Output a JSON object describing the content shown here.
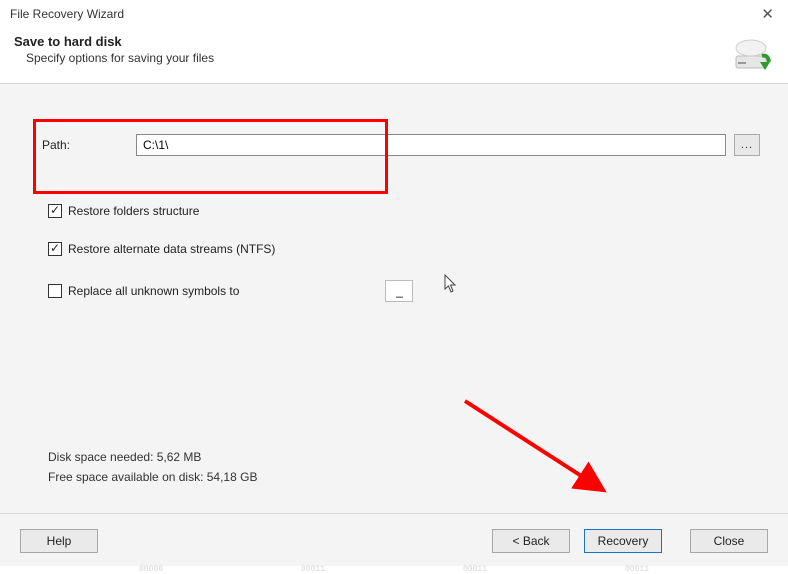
{
  "window": {
    "title": "File Recovery Wizard"
  },
  "header": {
    "title": "Save to hard disk",
    "subtitle": "Specify options for saving your files"
  },
  "path": {
    "label": "Path:",
    "value": "C:\\1\\",
    "browse_label": "..."
  },
  "options": {
    "restore_folders": {
      "label": "Restore folders structure",
      "checked": true
    },
    "restore_ads": {
      "label": "Restore alternate data streams (NTFS)",
      "checked": true
    },
    "replace_symbols": {
      "label": "Replace all unknown symbols to",
      "checked": false,
      "value": "_"
    }
  },
  "info": {
    "disk_needed": "Disk space needed: 5,62 MB",
    "free_space": "Free space available on disk: 54,18 GB"
  },
  "buttons": {
    "help": "Help",
    "back": "< Back",
    "recovery": "Recovery",
    "close": "Close"
  }
}
